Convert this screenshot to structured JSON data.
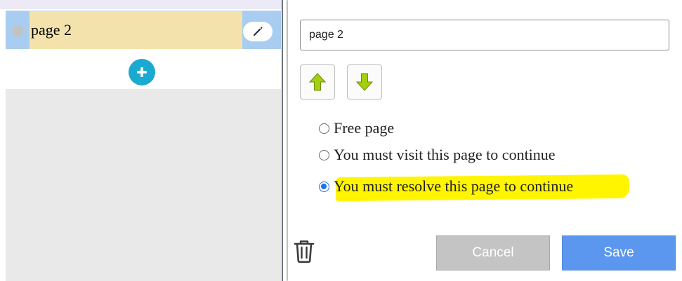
{
  "left_panel": {
    "pages": [
      {
        "label": "page 2"
      }
    ],
    "icons": {
      "status": "circle-dot-icon",
      "edit": "pencil-icon",
      "add": "plus-icon"
    }
  },
  "editor": {
    "name_value": "page 2",
    "icons": {
      "up": "arrow-up-icon",
      "down": "arrow-down-icon",
      "delete": "trash-icon"
    },
    "options": [
      {
        "label": "Free page",
        "checked": false
      },
      {
        "label": "You must visit this page to continue",
        "checked": false
      },
      {
        "label": "You must resolve this page to continue",
        "checked": true
      }
    ],
    "cancel_label": "Cancel",
    "save_label": "Save"
  },
  "colors": {
    "accent_blue": "#5b97ee",
    "add_button": "#1aa9d0",
    "highlight": "#fff500",
    "page_label_bg": "#f3e2ac",
    "page_row_bg": "#a9cdf1",
    "arrow_green": "#9ccc0e"
  }
}
